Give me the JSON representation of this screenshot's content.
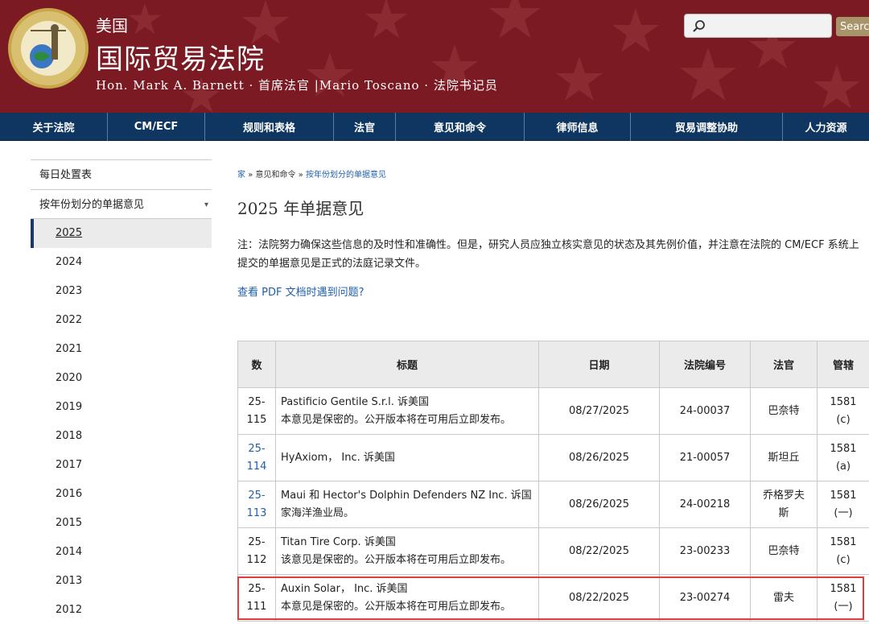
{
  "header": {
    "title_small": "美国",
    "title_large": "国际贸易法院",
    "subtitle": "Hon. Mark A. Barnett · 首席法官 |Mario Toscano · 法院书记员",
    "seal_icon": "court-seal-icon",
    "search": {
      "placeholder": "",
      "button_label": "Search"
    }
  },
  "nav": {
    "items": [
      {
        "label": "关于法院"
      },
      {
        "label": "CM/ECF"
      },
      {
        "label": "规则和表格"
      },
      {
        "label": "法官"
      },
      {
        "label": "意见和命令"
      },
      {
        "label": "律师信息"
      },
      {
        "label": "贸易调整协助"
      },
      {
        "label": "人力资源"
      }
    ]
  },
  "sidebar": {
    "links": [
      {
        "label": "每日处置表"
      },
      {
        "label": "按年份划分的单据意见",
        "arrow": "▾"
      }
    ],
    "years": [
      "2025",
      "2024",
      "2023",
      "2022",
      "2021",
      "2020",
      "2019",
      "2018",
      "2017",
      "2016",
      "2015",
      "2014",
      "2013",
      "2012"
    ],
    "active_year": "2025"
  },
  "breadcrumb": {
    "home": "家",
    "sep": "»",
    "level1": "意见和命令",
    "level2": "按年份划分的单据意见"
  },
  "page": {
    "title": "2025 年单据意见",
    "note": "注：法院努力确保这些信息的及时性和准确性。但是，研究人员应独立核实意见的状态及其先例价值，并注意在法院的 CM/ECF 系统上提交的单据意见是正式的法庭记录文件。",
    "pdf_link": "查看 PDF 文档时遇到问题?"
  },
  "table": {
    "headers": [
      "数",
      "标题",
      "日期",
      "法院编号",
      "法官",
      "管辖"
    ],
    "rows": [
      {
        "num1": "25-",
        "num2": "115",
        "link": false,
        "title1": "Pastificio Gentile S.r.l. 诉美国",
        "title2": "本意见是保密的。公开版本将在可用后立即发布。",
        "date": "08/27/2025",
        "court_no": "24-00037",
        "judge1": "巴奈特",
        "judge2": "",
        "juris1": "1581",
        "juris2": "(c)"
      },
      {
        "num1": "25-",
        "num2": "114",
        "link": true,
        "title1": "HyAxiom， Inc. 诉美国",
        "title2": "",
        "date": "08/26/2025",
        "court_no": "21-00057",
        "judge1": "斯坦丘",
        "judge2": "",
        "juris1": "1581",
        "juris2": "(a)"
      },
      {
        "num1": "25-",
        "num2": "113",
        "link": true,
        "title1": "Maui 和 Hector's Dolphin Defenders NZ Inc. 诉国",
        "title2": "家海洋渔业局。",
        "date": "08/26/2025",
        "court_no": "24-00218",
        "judge1": "乔格罗夫",
        "judge2": "斯",
        "juris1": "1581",
        "juris2": "(一)"
      },
      {
        "num1": "25-",
        "num2": "112",
        "link": false,
        "title1": "Titan Tire Corp. 诉美国",
        "title2": "该意见是保密的。公开版本将在可用后立即发布。",
        "date": "08/22/2025",
        "court_no": "23-00233",
        "judge1": "巴奈特",
        "judge2": "",
        "juris1": "1581",
        "juris2": "(c)"
      },
      {
        "num1": "25-",
        "num2": "111",
        "link": false,
        "title1": "Auxin Solar， Inc. 诉美国",
        "title2": "本意见是保密的。公开版本将在可用后立即发布。",
        "date": "08/22/2025",
        "court_no": "23-00274",
        "judge1": "雷夫",
        "judge2": "",
        "juris1": "1581",
        "juris2": "(一)"
      }
    ]
  },
  "colors": {
    "header_bg": "#7b1a22",
    "nav_bg": "#0f3561",
    "link": "#1f5fa8",
    "highlight": "#e33a3a"
  }
}
